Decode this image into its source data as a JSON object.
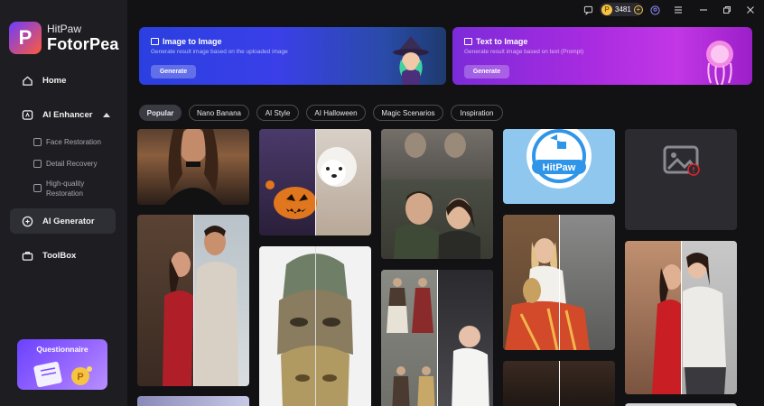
{
  "app": {
    "brand_top": "HitPaw",
    "brand_main": "FotorPea",
    "logo_letter": "P"
  },
  "sidebar": {
    "home": "Home",
    "ai_enhancer": "AI Enhancer",
    "sub_items": [
      "Face Restoration",
      "Detail Recovery",
      "High-quality Restoration"
    ],
    "ai_generator": "AI Generator",
    "toolbox": "ToolBox",
    "promo_label": "Questionnaire"
  },
  "titlebar": {
    "credits": "3481"
  },
  "banners": [
    {
      "title": "Image to Image",
      "desc": "Generate result image based on the uploaded image",
      "button": "Generate"
    },
    {
      "title": "Text to Image",
      "desc": "Generate result image based on text (Prompt)",
      "button": "Generate"
    }
  ],
  "tabs": [
    "Popular",
    "Nano Banana",
    "AI Style",
    "AI Halloween",
    "Magic Scenarios",
    "Inspiration"
  ],
  "gallery": {
    "hitpaw_logo_text": "HitPaw"
  },
  "colors": {
    "sidebar_bg": "#1e1e22",
    "app_bg": "#121214",
    "accent_purple": "#7b4bff",
    "coin": "#f6c343"
  }
}
